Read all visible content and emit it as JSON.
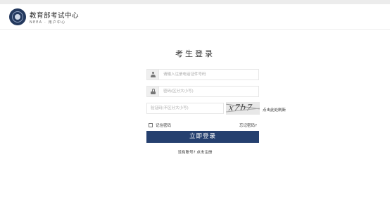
{
  "header": {
    "title": "教育部考试中心",
    "subtitle": "NEEA · 用户中心"
  },
  "login": {
    "title": "考生登录",
    "username_placeholder": "请输入注册电话证件号码",
    "password_placeholder": "密码(区分大小写)",
    "captcha_placeholder": "验证码(不区分大小写)",
    "captcha_text": "x7b7",
    "refresh_label": "点击此处刷新",
    "remember_label": "记住密码",
    "forgot_label": "忘记密码?",
    "login_button": "立即登录",
    "no_account_label": "没有账号?",
    "register_link": "点击注册"
  },
  "colors": {
    "primary": "#25406f",
    "logo": "#24395e"
  },
  "icons": {
    "username": "person-icon",
    "password": "lock-icon"
  }
}
